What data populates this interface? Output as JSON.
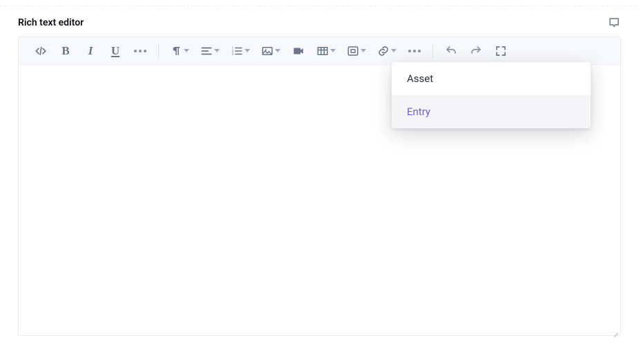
{
  "field": {
    "label": "Rich text editor"
  },
  "dropdown": {
    "items": [
      {
        "label": "Asset"
      },
      {
        "label": "Entry"
      }
    ]
  }
}
